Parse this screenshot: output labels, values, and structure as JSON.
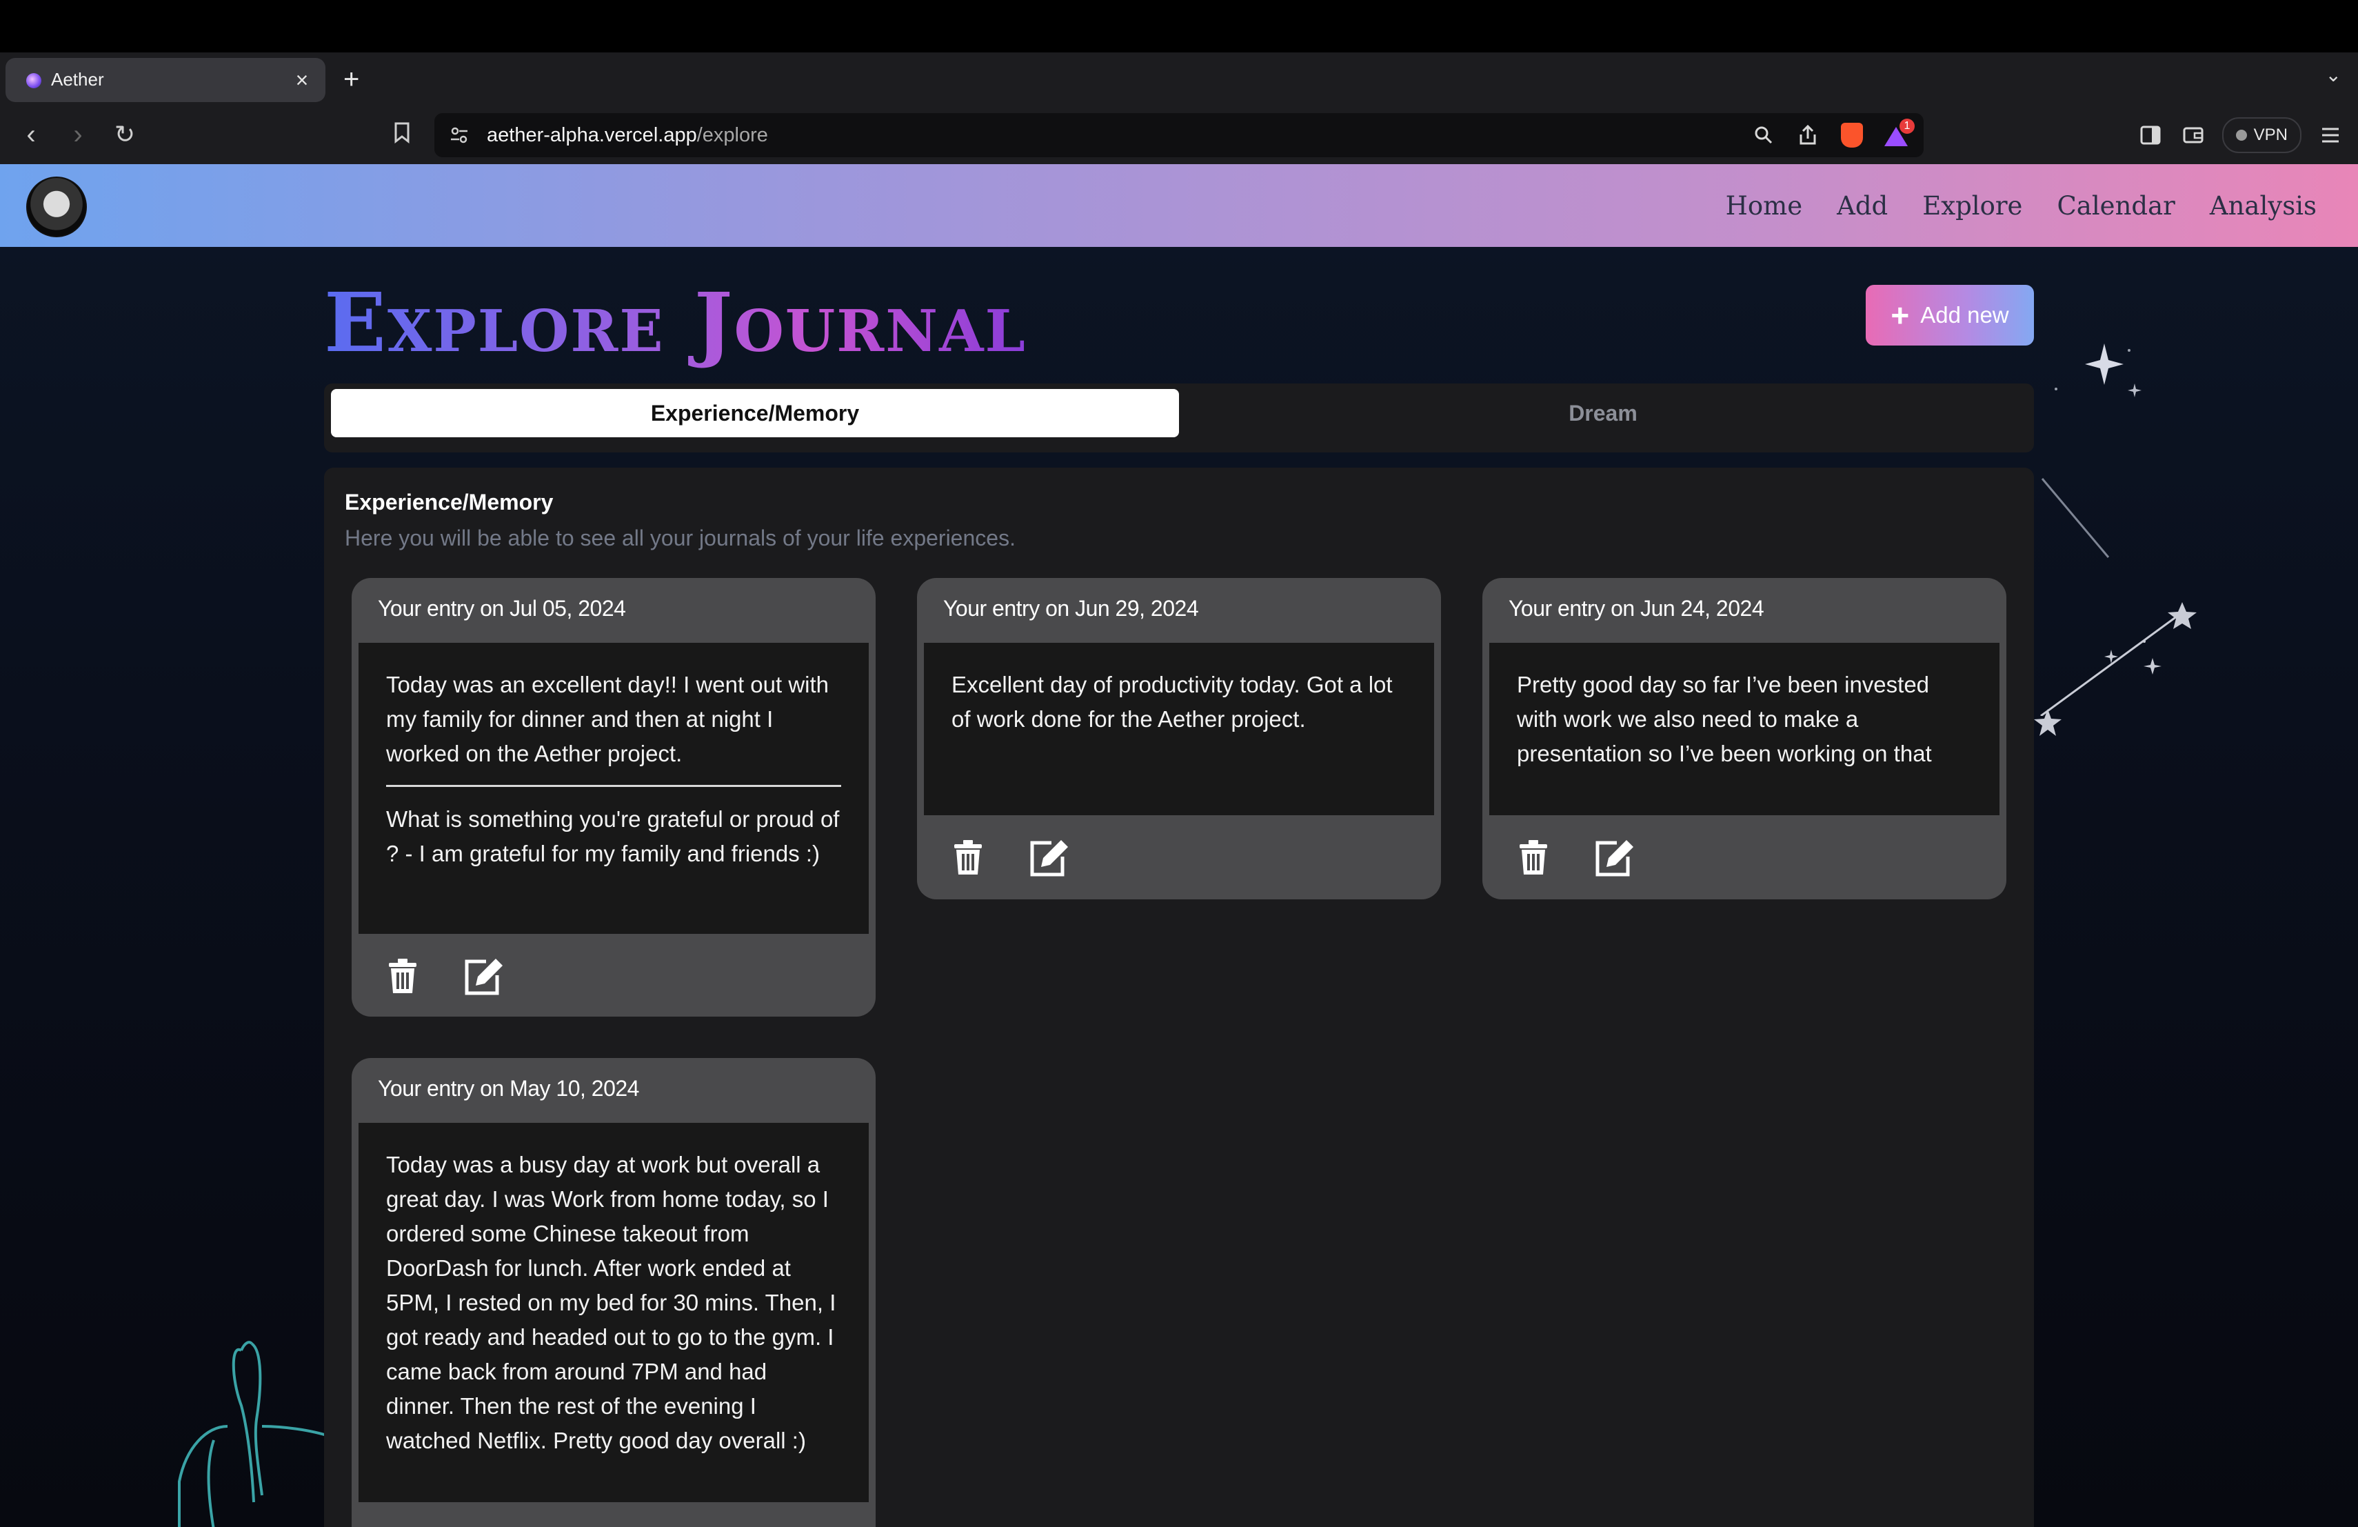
{
  "browser": {
    "tab_title": "Aether",
    "tab_close": "×",
    "new_tab": "+",
    "tabs_dropdown": "⌄",
    "url_host": "aether-alpha.vercel.app",
    "url_path": "/explore",
    "nav_back": "‹",
    "nav_forward": "›",
    "nav_reload": "↻",
    "rewards_count": "1",
    "vpn_label": "VPN"
  },
  "app": {
    "nav": [
      "Home",
      "Add",
      "Explore",
      "Calendar",
      "Analysis"
    ],
    "page_title": "Explore Journal",
    "add_new_label": "Add new",
    "add_new_icon": "+",
    "tabs": [
      "Experience/Memory",
      "Dream"
    ],
    "active_tab": "Experience/Memory",
    "section_title": "Experience/Memory",
    "section_description": "Here you will be able to see all your journals of your life experiences.",
    "entries": [
      {
        "date_label": "Your entry on Jul 05, 2024",
        "text": "Today was an excellent day!! I went out with my family for dinner and then at night I worked on the Aether project.",
        "prompt_answer": "What is something you're grateful or proud of ? - I am grateful for my family and friends :)"
      },
      {
        "date_label": "Your entry on Jun 29, 2024",
        "text": "Excellent day of productivity today. Got a lot of work done for the Aether project."
      },
      {
        "date_label": "Your entry on Jun 24, 2024",
        "text": "Pretty good day so far I’ve been invested with work we also need to make a presentation so I’ve been working on that"
      },
      {
        "date_label": "Your entry on May 10, 2024",
        "text": "Today was a busy day at work but overall a great day. I was Work from home today, so I ordered some Chinese takeout from DoorDash for lunch. After work ended at 5PM, I rested on my bed for 30 mins. Then, I got ready and headed out to go to the gym. I came back from around 7PM and had dinner. Then the rest of the evening I watched Netflix. Pretty good day overall :)"
      }
    ]
  },
  "icons": {
    "delete": "trash-icon",
    "edit": "edit-icon"
  },
  "colors": {
    "appbar_start": "#6fa3ee",
    "appbar_end": "#e886b8",
    "title_gradient_start": "#5a6cf0",
    "title_gradient_end": "#8a3dd8",
    "card_bg": "#4a4a4c",
    "card_body_bg": "#181818",
    "panel_bg": "#1b1b1d"
  }
}
